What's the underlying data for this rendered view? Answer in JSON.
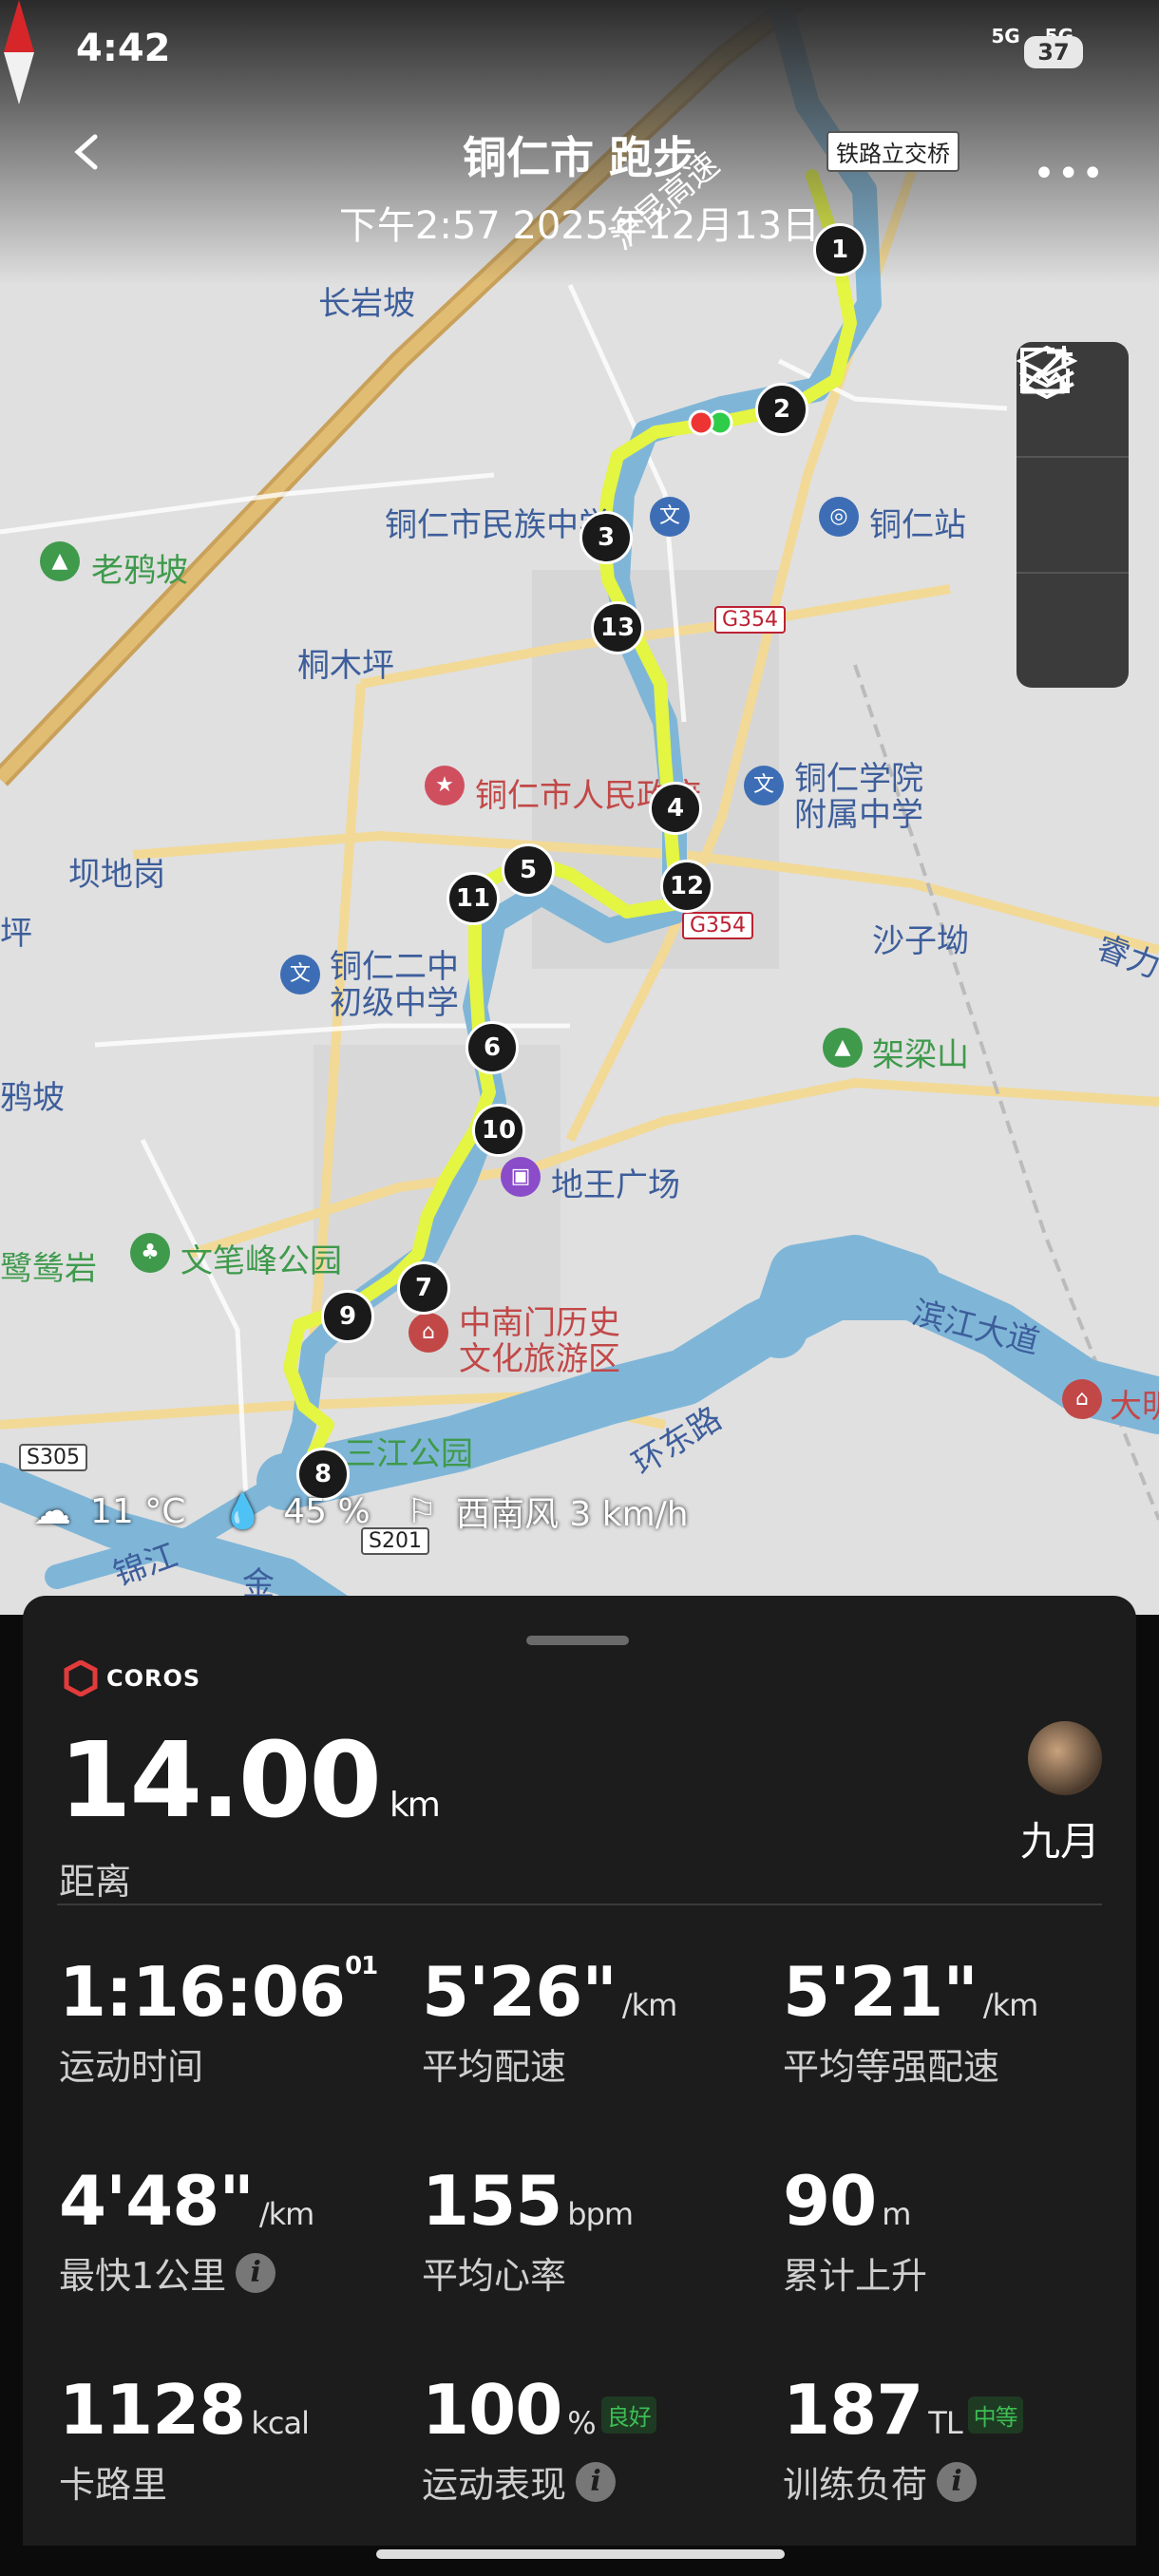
{
  "status": {
    "time": "4:42",
    "net1": "5G",
    "net2": "5G",
    "battery": "37"
  },
  "header": {
    "title": "铜仁市 跑步",
    "subtitle": "下午2:57 2025年12月13日"
  },
  "map": {
    "labels": [
      {
        "text": "长岩坡",
        "kind": "place"
      },
      {
        "text": "铁路立交桥",
        "kind": "road"
      },
      {
        "text": "老鸦坡",
        "kind": "park"
      },
      {
        "text": "铜仁市民族中学",
        "kind": "school"
      },
      {
        "text": "铜仁站",
        "kind": "station"
      },
      {
        "text": "桐木坪",
        "kind": "place"
      },
      {
        "text": "铜仁市人民政府",
        "kind": "gov"
      },
      {
        "text": "铜仁学院",
        "kind": "school"
      },
      {
        "text": "附属中学",
        "kind": "school"
      },
      {
        "text": "坝地岗",
        "kind": "place"
      },
      {
        "text": "沙子坳",
        "kind": "place"
      },
      {
        "text": "铜仁二中",
        "kind": "school"
      },
      {
        "text": "初级中学",
        "kind": "school"
      },
      {
        "text": "架梁山",
        "kind": "park"
      },
      {
        "text": "鸦坡",
        "kind": "place"
      },
      {
        "text": "地王广场",
        "kind": "mall"
      },
      {
        "text": "文笔峰公园",
        "kind": "park"
      },
      {
        "text": "鹭鸶岩",
        "kind": "park"
      },
      {
        "text": "滨江大道",
        "kind": "road"
      },
      {
        "text": "中南门历史",
        "kind": "scenic"
      },
      {
        "text": "文化旅游区",
        "kind": "scenic"
      },
      {
        "text": "大明",
        "kind": "scenic"
      },
      {
        "text": "环东路",
        "kind": "road"
      },
      {
        "text": "三江公园",
        "kind": "park"
      },
      {
        "text": "锦江",
        "kind": "river"
      },
      {
        "text": "金",
        "kind": "road"
      },
      {
        "text": "睿力",
        "kind": "place"
      },
      {
        "text": "坪",
        "kind": "place"
      },
      {
        "text": "沪昆高速",
        "kind": "road"
      }
    ],
    "shields": [
      "G354",
      "G354",
      "S305",
      "S201"
    ],
    "waypoints": [
      "1",
      "2",
      "3",
      "13",
      "4",
      "12",
      "5",
      "11",
      "6",
      "10",
      "7",
      "9",
      "8"
    ]
  },
  "weather": {
    "temp": "11 °C",
    "humidity": "45  %",
    "wind": "西南风 3 km/h"
  },
  "card": {
    "brand": "COROS",
    "distance": {
      "value": "14.00",
      "unit": "km",
      "label": "距离"
    },
    "user": "九月",
    "stats": [
      {
        "value": "1:16:06",
        "sup": "01",
        "unit": "",
        "label": "运动时间"
      },
      {
        "value": "5'26\"",
        "unit": "/km",
        "label": "平均配速"
      },
      {
        "value": "5'21\"",
        "unit": "/km",
        "label": "平均等强配速"
      },
      {
        "value": "4'48\"",
        "unit": "/km",
        "label": "最快1公里"
      },
      {
        "value": "155",
        "unit": "bpm",
        "label": "平均心率"
      },
      {
        "value": "90",
        "unit": "m",
        "label": "累计上升"
      },
      {
        "value": "1128",
        "unit": "kcal",
        "label": "卡路里"
      },
      {
        "value": "100",
        "unit": "%",
        "tag": "良好",
        "label": "运动表现"
      },
      {
        "value": "187",
        "unit": "TL",
        "tag": "中等",
        "label": "训练负荷"
      }
    ]
  },
  "colors": {
    "route": "#e4f542",
    "river": "#7fb6d8",
    "card": "#1c1c1c",
    "good": "#3dbd54"
  }
}
